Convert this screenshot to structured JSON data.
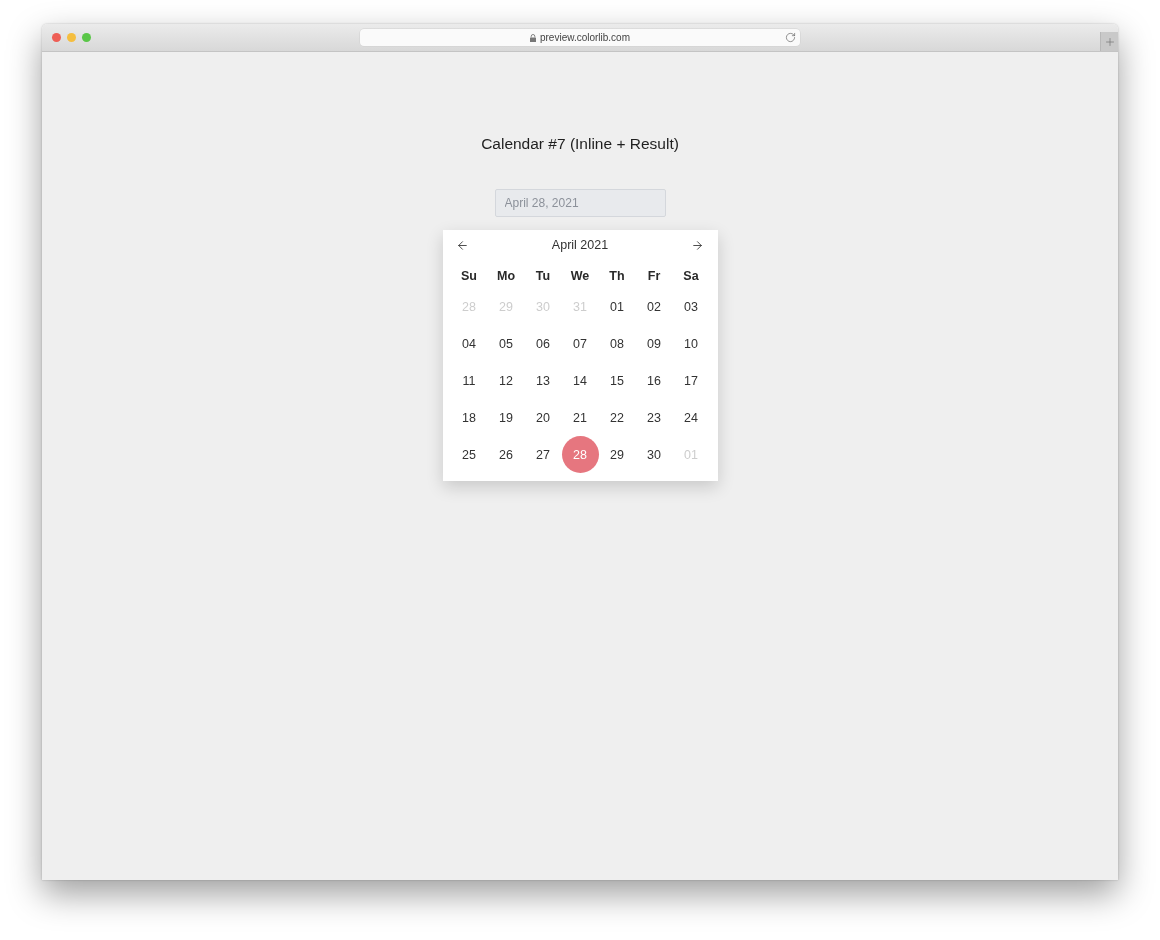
{
  "browser": {
    "url": "preview.colorlib.com"
  },
  "page": {
    "title": "Calendar #7 (Inline + Result)"
  },
  "date_field": {
    "value": "April 28, 2021"
  },
  "calendar": {
    "month_label": "April 2021",
    "weekdays": [
      "Su",
      "Mo",
      "Tu",
      "We",
      "Th",
      "Fr",
      "Sa"
    ],
    "weeks": [
      [
        {
          "label": "28",
          "outside": true,
          "selected": false
        },
        {
          "label": "29",
          "outside": true,
          "selected": false
        },
        {
          "label": "30",
          "outside": true,
          "selected": false
        },
        {
          "label": "31",
          "outside": true,
          "selected": false
        },
        {
          "label": "01",
          "outside": false,
          "selected": false
        },
        {
          "label": "02",
          "outside": false,
          "selected": false
        },
        {
          "label": "03",
          "outside": false,
          "selected": false
        }
      ],
      [
        {
          "label": "04",
          "outside": false,
          "selected": false
        },
        {
          "label": "05",
          "outside": false,
          "selected": false
        },
        {
          "label": "06",
          "outside": false,
          "selected": false
        },
        {
          "label": "07",
          "outside": false,
          "selected": false
        },
        {
          "label": "08",
          "outside": false,
          "selected": false
        },
        {
          "label": "09",
          "outside": false,
          "selected": false
        },
        {
          "label": "10",
          "outside": false,
          "selected": false
        }
      ],
      [
        {
          "label": "11",
          "outside": false,
          "selected": false
        },
        {
          "label": "12",
          "outside": false,
          "selected": false
        },
        {
          "label": "13",
          "outside": false,
          "selected": false
        },
        {
          "label": "14",
          "outside": false,
          "selected": false
        },
        {
          "label": "15",
          "outside": false,
          "selected": false
        },
        {
          "label": "16",
          "outside": false,
          "selected": false
        },
        {
          "label": "17",
          "outside": false,
          "selected": false
        }
      ],
      [
        {
          "label": "18",
          "outside": false,
          "selected": false
        },
        {
          "label": "19",
          "outside": false,
          "selected": false
        },
        {
          "label": "20",
          "outside": false,
          "selected": false
        },
        {
          "label": "21",
          "outside": false,
          "selected": false
        },
        {
          "label": "22",
          "outside": false,
          "selected": false
        },
        {
          "label": "23",
          "outside": false,
          "selected": false
        },
        {
          "label": "24",
          "outside": false,
          "selected": false
        }
      ],
      [
        {
          "label": "25",
          "outside": false,
          "selected": false
        },
        {
          "label": "26",
          "outside": false,
          "selected": false
        },
        {
          "label": "27",
          "outside": false,
          "selected": false
        },
        {
          "label": "28",
          "outside": false,
          "selected": true
        },
        {
          "label": "29",
          "outside": false,
          "selected": false
        },
        {
          "label": "30",
          "outside": false,
          "selected": false
        },
        {
          "label": "01",
          "outside": true,
          "selected": false
        }
      ]
    ]
  }
}
